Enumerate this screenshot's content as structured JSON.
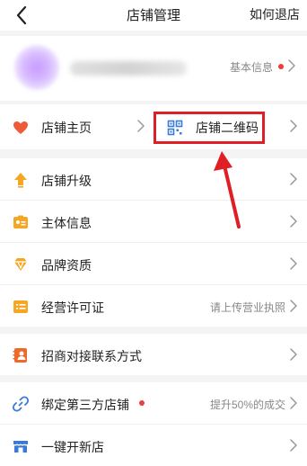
{
  "nav": {
    "title": "店铺管理",
    "right_link": "如何退店"
  },
  "profile": {
    "info_label": "基本信息"
  },
  "home": {
    "label": "店铺主页",
    "qr_label": "店铺二维码"
  },
  "section2": [
    {
      "label": "店铺升级",
      "sub": ""
    },
    {
      "label": "主体信息",
      "sub": ""
    },
    {
      "label": "品牌资质",
      "sub": ""
    },
    {
      "label": "经营许可证",
      "sub": "请上传营业执照"
    }
  ],
  "section3": [
    {
      "label": "招商对接联系方式",
      "sub": ""
    }
  ],
  "section4": [
    {
      "label": "绑定第三方店铺",
      "sub": "提升50%的成交"
    },
    {
      "label": "一键开新店",
      "sub": ""
    }
  ],
  "colors": {
    "accent_red": "#e01e26",
    "dot_red": "#ee3b3b",
    "icon_orange": "#f5a623",
    "icon_blue": "#3a7bd5"
  },
  "icons": {
    "back": "chevron-left-icon",
    "home": "heart-icon",
    "qr": "qr-code-icon",
    "upgrade": "arrow-up-icon",
    "entity": "id-card-icon",
    "brand": "diamond-icon",
    "license": "license-icon",
    "contact": "contact-book-icon",
    "bind": "link-icon",
    "newstore": "storefront-icon"
  }
}
